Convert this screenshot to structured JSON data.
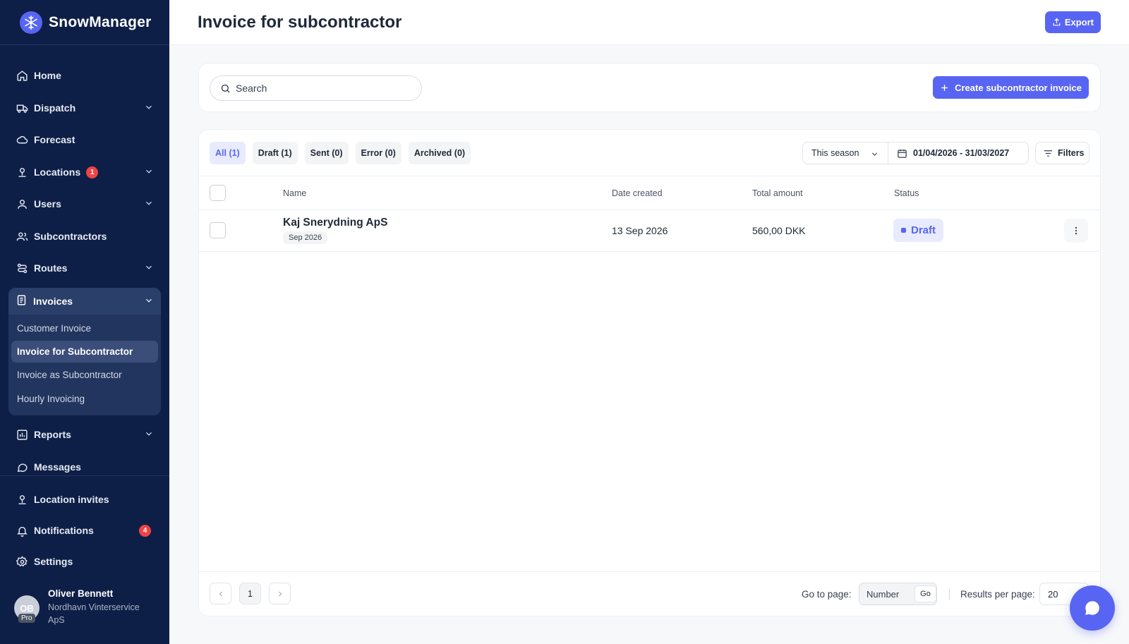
{
  "app": {
    "name": "SnowManager"
  },
  "sidebar": {
    "items": [
      {
        "label": "Home",
        "icon": "home-icon"
      },
      {
        "label": "Dispatch",
        "icon": "truck-icon"
      },
      {
        "label": "Forecast",
        "icon": "cloud-icon"
      },
      {
        "label": "Locations",
        "icon": "location-pin-icon",
        "badge": "1"
      },
      {
        "label": "Users",
        "icon": "user-icon"
      },
      {
        "label": "Subcontractors",
        "icon": "users-icon"
      },
      {
        "label": "Routes",
        "icon": "route-icon"
      },
      {
        "label": "Invoices",
        "icon": "invoice-icon"
      },
      {
        "label": "Reports",
        "icon": "bar-chart-icon"
      },
      {
        "label": "Messages",
        "icon": "message-icon"
      }
    ],
    "invoice_sub": [
      "Customer Invoice",
      "Invoice for Subcontractor",
      "Invoice as Subcontractor",
      "Hourly Invoicing"
    ],
    "bottom": [
      {
        "label": "Location invites",
        "icon": "location-invite-icon"
      },
      {
        "label": "Notifications",
        "icon": "bell-icon",
        "badge": "4"
      },
      {
        "label": "Settings",
        "icon": "gear-icon"
      }
    ],
    "user": {
      "initials": "OB",
      "plan": "Pro",
      "name": "Oliver Bennett",
      "org": "Nordhavn Vinterservice ApS"
    }
  },
  "header": {
    "title": "Invoice for subcontractor",
    "export_label": "Export"
  },
  "search": {
    "placeholder": "Search",
    "create_label": "Create subcontractor invoice"
  },
  "tabs": [
    "All (1)",
    "Draft (1)",
    "Sent (0)",
    "Error (0)",
    "Archived (0)"
  ],
  "filters": {
    "season": "This season",
    "date_range": "01/04/2026 - 31/03/2027",
    "filters_label": "Filters"
  },
  "table": {
    "columns": [
      "Name",
      "Date created",
      "Total amount",
      "Status"
    ],
    "rows": [
      {
        "name": "Kaj Snerydning ApS",
        "period": "Sep 2026",
        "date_created": "13 Sep 2026",
        "total": "560,00 DKK",
        "status": "Draft"
      }
    ]
  },
  "pagination": {
    "page": "1",
    "goto_label": "Go to page:",
    "goto_placeholder": "Number",
    "go_label": "Go",
    "rpp_label": "Results per page:",
    "rpp_value": "20"
  },
  "colors": {
    "sidebar_bg": "#0e1f47",
    "accent": "#5865f2",
    "badge": "#ef4444"
  }
}
